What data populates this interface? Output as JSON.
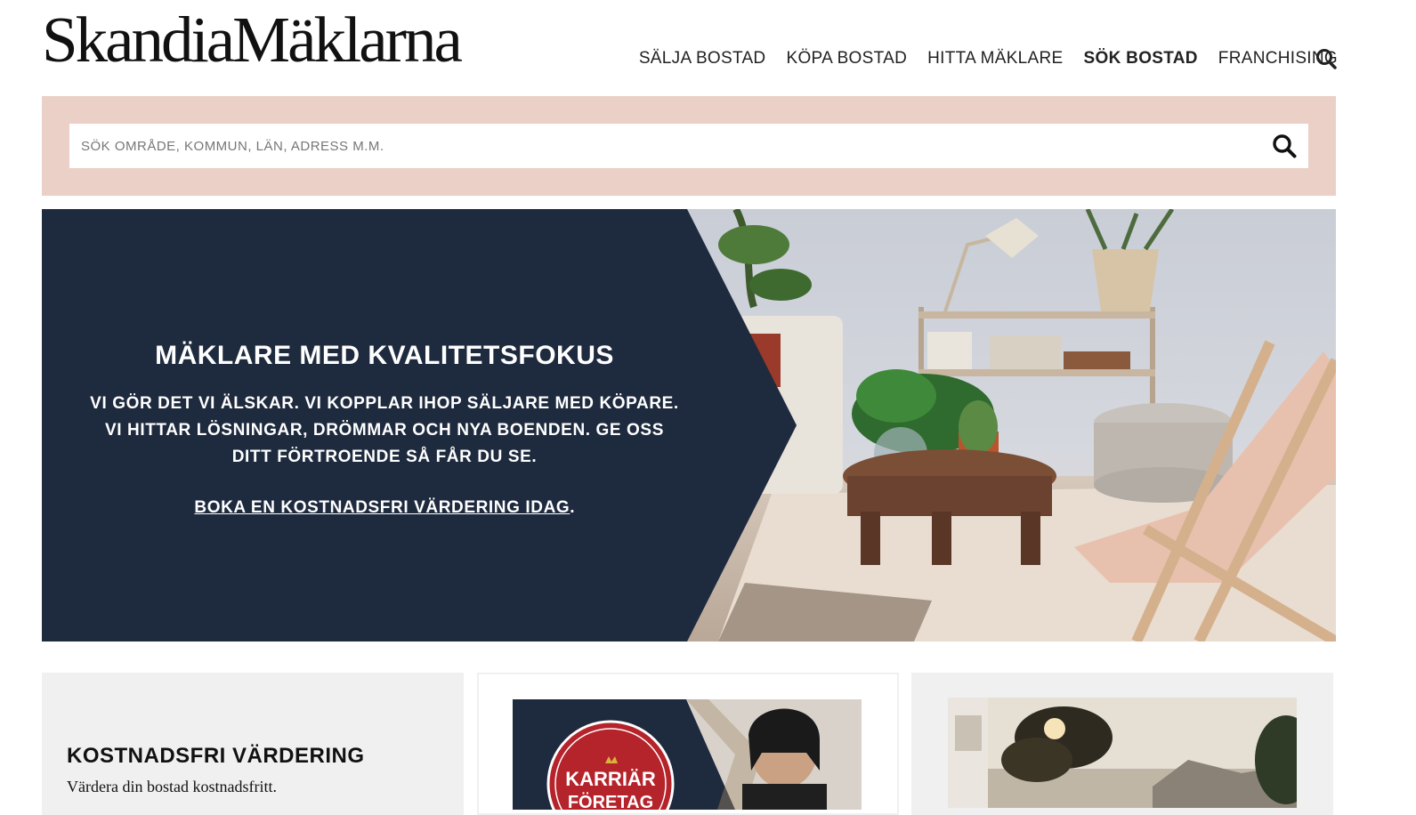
{
  "header": {
    "logo": "SkandiaMäklarna",
    "nav": [
      {
        "label": "SÄLJA BOSTAD",
        "active": false
      },
      {
        "label": "KÖPA BOSTAD",
        "active": false
      },
      {
        "label": "HITTA MÄKLARE",
        "active": false
      },
      {
        "label": "SÖK BOSTAD",
        "active": true
      },
      {
        "label": "FRANCHISING",
        "active": false
      }
    ],
    "search_icon": "search-icon"
  },
  "search": {
    "placeholder": "SÖK OMRÅDE, KOMMUN, LÄN, ADRESS M.M.",
    "value": "",
    "button_icon": "search-icon"
  },
  "hero": {
    "title": "MÄKLARE MED KVALITETSFOKUS",
    "lines": [
      "VI GÖR DET VI ÄLSKAR. VI KOPPLAR IHOP SÄLJARE MED KÖPARE.",
      "VI HITTAR LÖSNINGAR, DRÖMMAR OCH NYA BOENDEN. GE OSS",
      "DITT FÖRTROENDE SÅ FÅR DU SE."
    ],
    "link": "BOKA EN KOSTNADSFRI VÄRDERING IDAG",
    "link_suffix": "."
  },
  "cards": [
    {
      "title": "KOSTNADSFRI VÄRDERING",
      "text": "Värdera din bostad kostnadsfritt."
    },
    {
      "badge_line1": "KARRIÄR",
      "badge_line2": "FÖRETAG"
    },
    {}
  ],
  "colors": {
    "navy": "#1e2a3e",
    "blush": "#ead0c6",
    "card_grey": "#f1f0f0",
    "badge_red": "#b5232b"
  }
}
